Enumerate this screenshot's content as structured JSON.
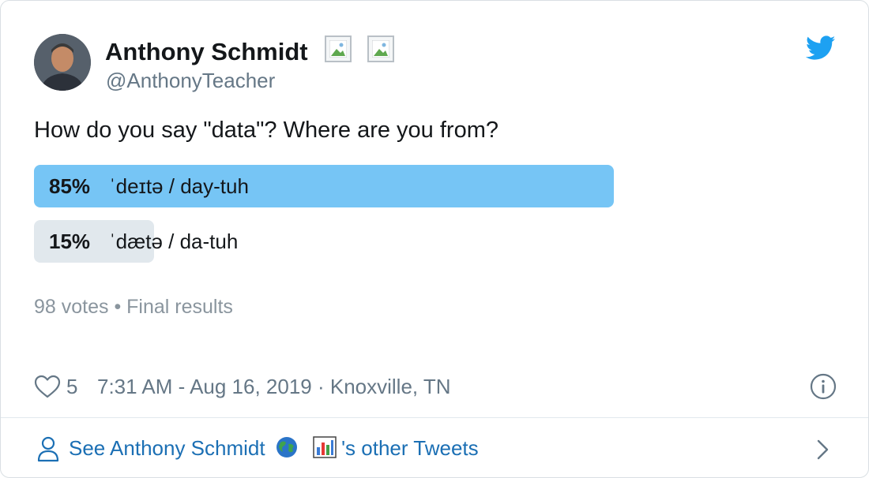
{
  "author": {
    "name": "Anthony Schmidt",
    "handle": "@AnthonyTeacher"
  },
  "tweet": {
    "text": "How do you say \"data\"? Where are you from?"
  },
  "poll": {
    "options": [
      {
        "percent": "85%",
        "fraction": 0.85,
        "label": "ˈdeɪtə / day-tuh",
        "color": "#76c5f5"
      },
      {
        "percent": "15%",
        "fraction": 0.15,
        "label": "ˈdætə / da-tuh",
        "color": "#e1e8ed"
      }
    ],
    "meta": "98 votes • Final results"
  },
  "footer": {
    "likes": "5",
    "timestamp": "7:31 AM - Aug 16, 2019 · Knoxville, TN"
  },
  "see_more": {
    "prefix": "See Anthony Schmidt",
    "suffix": "'s other Tweets"
  },
  "icons": {
    "logo": "twitter-bird-icon",
    "like": "heart-icon",
    "info": "info-icon",
    "user": "user-icon",
    "chevron": "chevron-right-icon"
  },
  "colors": {
    "brand": "#1da1f2",
    "link": "#1b6fb4",
    "muted": "#657786"
  }
}
